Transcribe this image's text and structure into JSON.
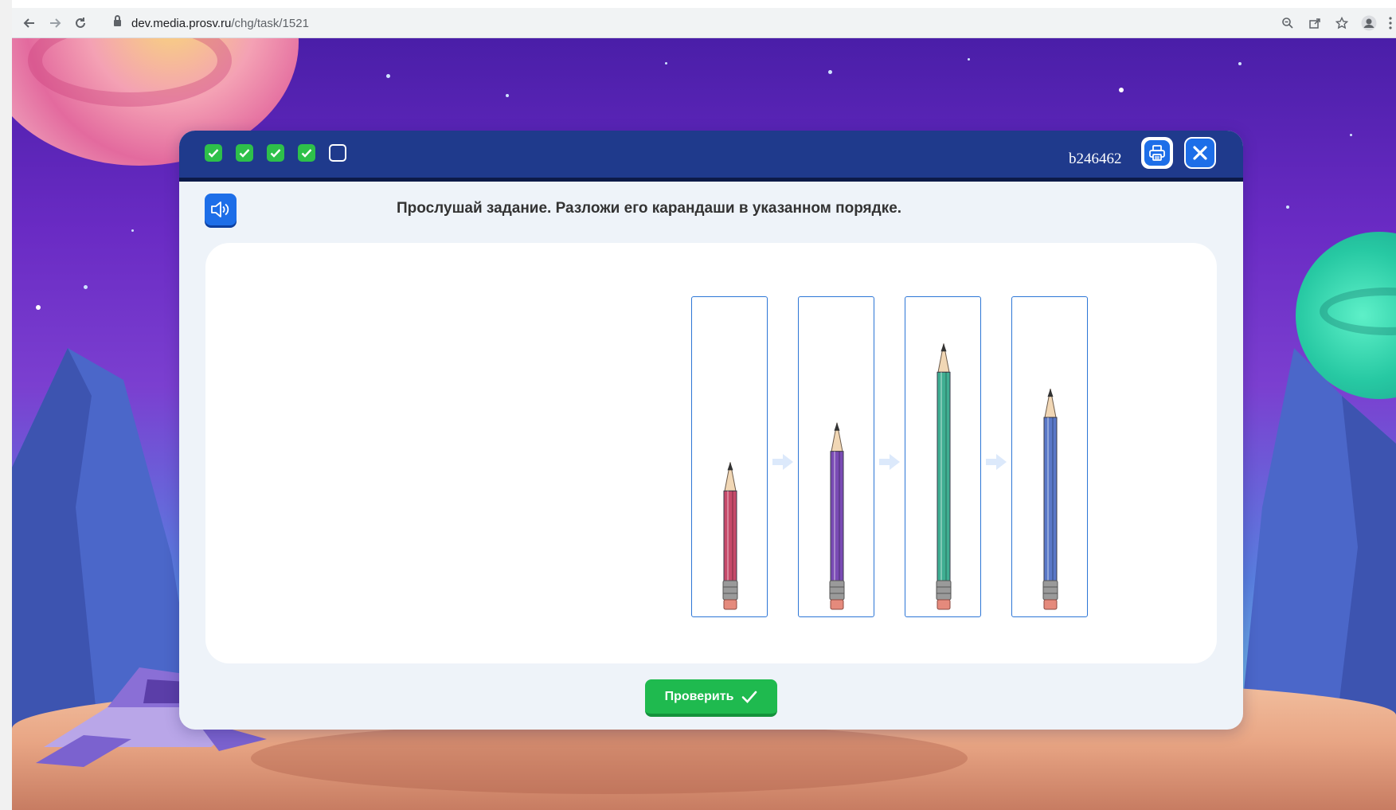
{
  "browser": {
    "url_host": "dev.media.prosv.ru",
    "url_path": "/chg/task/1521"
  },
  "header": {
    "progress": [
      "done",
      "done",
      "done",
      "done",
      "todo"
    ],
    "task_code": "b246462"
  },
  "task": {
    "instruction": "Прослушай задание. Разложи его карандаши в указанном порядке."
  },
  "cards": [
    {
      "pencil_color": "#c64a6a",
      "pencil_length": 0.52
    },
    {
      "pencil_color": "#7a4bb5",
      "pencil_length": 0.66
    },
    {
      "pencil_color": "#3fae92",
      "pencil_length": 0.94
    },
    {
      "pencil_color": "#5a78c8",
      "pencil_length": 0.78
    }
  ],
  "footer": {
    "check_label": "Проверить"
  },
  "colors": {
    "header_bg": "#1f3a8c",
    "accent_blue": "#1d6ee8",
    "success_green": "#1fba4f"
  }
}
